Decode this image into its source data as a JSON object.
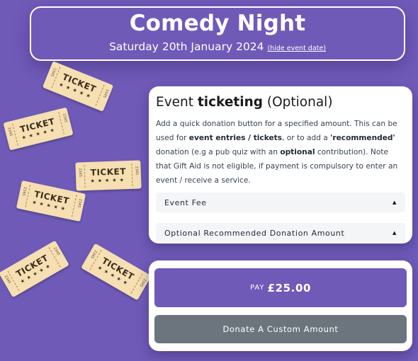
{
  "header": {
    "title": "Comedy Night",
    "date": "Saturday 20th January 2024",
    "hide_link": "(hide event date)"
  },
  "decor": {
    "ticket_word": "TICKET",
    "ticket_stars": "★★★★★",
    "ticket_number": "2345",
    "ticket_color": "#f5dfb3"
  },
  "ticketing": {
    "title_plain": "Event ",
    "title_bold": "ticketing",
    "title_suffix": " (Optional)",
    "desc_1": "Add a quick donation button for a specified amount. This can be used for ",
    "desc_b1": "event entries / tickets",
    "desc_2": ", or to add a ",
    "desc_b2": "'recommended'",
    "desc_3": " donation (e.g a pub quiz with an ",
    "desc_b3": "optional",
    "desc_4": " contribution). Note that Gift Aid is not eligible, if payment is compulsory to enter an event / receive a service.",
    "sections": [
      {
        "label": "Event Fee",
        "icon": "caret-up-icon"
      },
      {
        "label": "Optional Recommended Donation Amount",
        "icon": "caret-up-icon"
      }
    ]
  },
  "payment": {
    "pay_prefix": "PAY",
    "pay_amount": "£25.00",
    "donate_label": "Donate A Custom Amount"
  },
  "colors": {
    "background": "#6f5ab8",
    "accent": "#6f5ab8",
    "secondary_button": "#6c757d"
  }
}
